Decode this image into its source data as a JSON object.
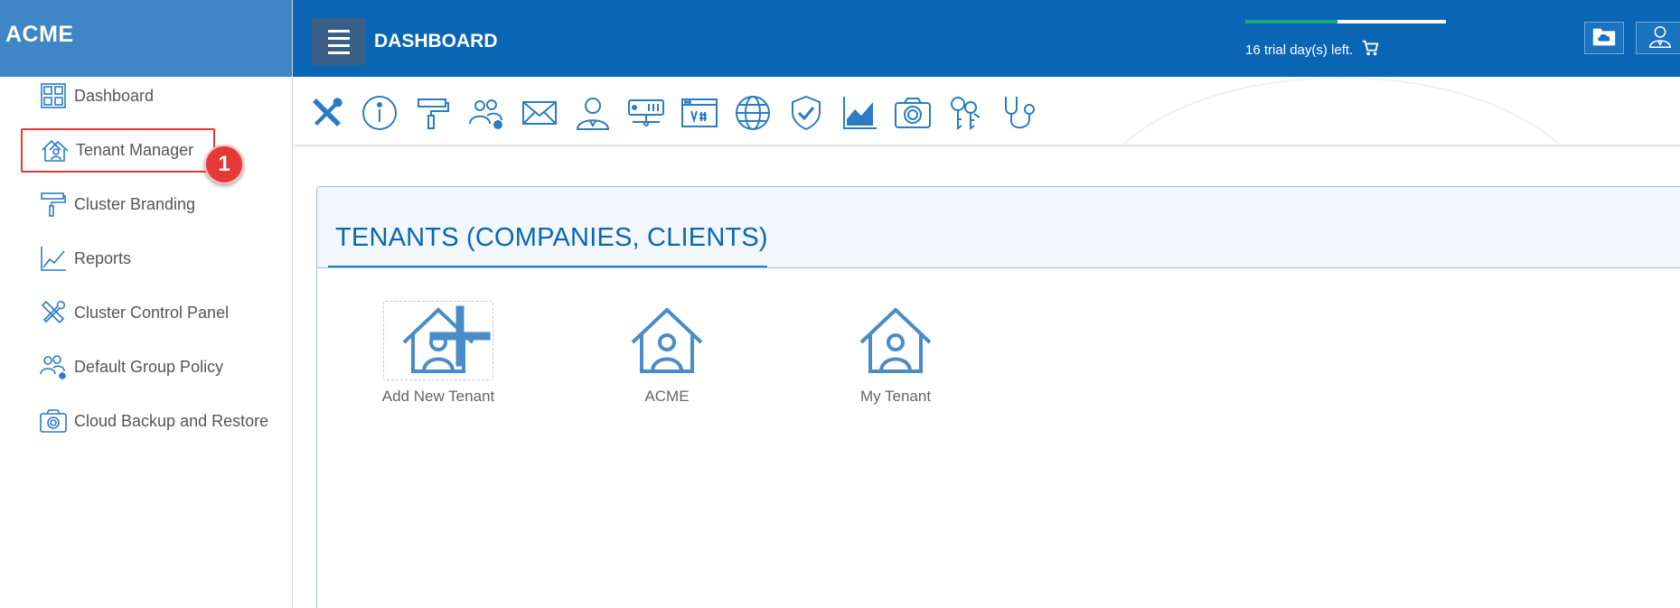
{
  "brand": "ACME",
  "sidebar": {
    "items": [
      {
        "label": "Dashboard",
        "icon": "dashboard-grid-icon"
      },
      {
        "label": "Tenant Manager",
        "icon": "tenant-house-icon"
      },
      {
        "label": "Cluster Branding",
        "icon": "paint-roller-icon"
      },
      {
        "label": "Reports",
        "icon": "line-chart-icon"
      },
      {
        "label": "Cluster Control Panel",
        "icon": "tools-icon"
      },
      {
        "label": "Default Group Policy",
        "icon": "group-settings-icon"
      },
      {
        "label": "Cloud Backup and Restore",
        "icon": "camera-icon"
      }
    ],
    "step_badge": "1"
  },
  "header": {
    "title": "DASHBOARD",
    "trial_text": "16 trial day(s) left.",
    "trial_progress": 0.46,
    "icons": [
      "cloud-folder-icon",
      "user-profile-icon"
    ]
  },
  "toolbar": {
    "icons": [
      "tools-icon",
      "info-icon",
      "paint-roller-icon",
      "group-settings-icon",
      "mail-icon",
      "user-icon",
      "server-icon",
      "web-window-icon",
      "globe-icon",
      "shield-check-icon",
      "area-chart-icon",
      "camera-icon",
      "keys-icon",
      "stethoscope-icon"
    ]
  },
  "panel": {
    "title": "TENANTS (COMPANIES, CLIENTS)",
    "tenants": [
      {
        "label": "Add New Tenant",
        "icon": "add-tenant-icon"
      },
      {
        "label": "ACME",
        "icon": "tenant-house-icon"
      },
      {
        "label": "My Tenant",
        "icon": "tenant-house-icon"
      }
    ]
  },
  "colors": {
    "header_bg": "#0a66b4",
    "brand_bg": "#3e86c6",
    "icon_blue": "#2a7cc4",
    "highlight_red": "#e53935",
    "trial_green": "#1fa37a"
  }
}
